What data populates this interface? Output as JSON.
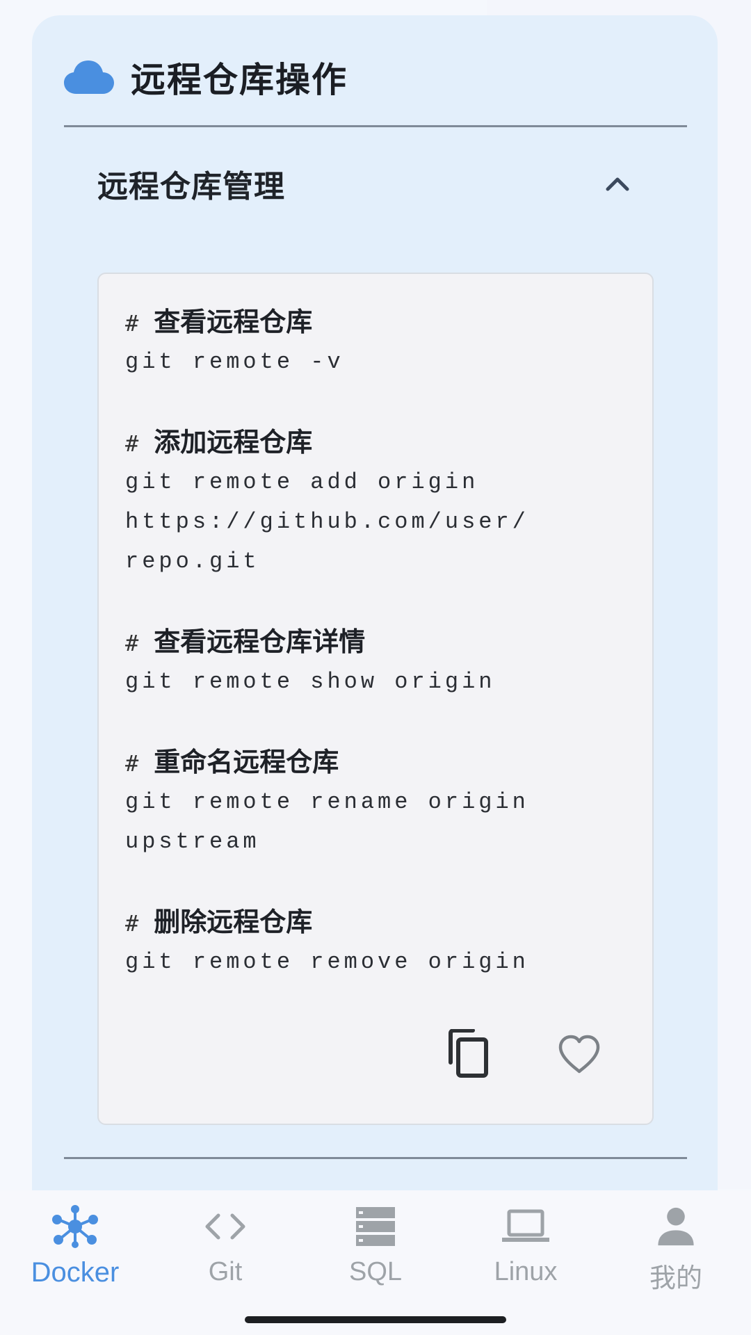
{
  "header": {
    "title": "远程仓库操作",
    "icon": "cloud-icon",
    "icon_color": "#4a8fe0"
  },
  "subsection": {
    "title": "远程仓库管理",
    "icon": "chevron-up-icon",
    "expanded": true
  },
  "code_blocks": [
    {
      "comment_hash": "#",
      "comment": "查看远程仓库",
      "lines": [
        "git remote -v"
      ]
    },
    {
      "comment_hash": "#",
      "comment": "添加远程仓库",
      "lines": [
        "git remote add origin",
        "https://github.com/user/",
        "repo.git"
      ]
    },
    {
      "comment_hash": "#",
      "comment": "查看远程仓库详情",
      "lines": [
        "git remote show origin"
      ]
    },
    {
      "comment_hash": "#",
      "comment": "重命名远程仓库",
      "lines": [
        "git remote rename origin",
        "upstream"
      ]
    },
    {
      "comment_hash": "#",
      "comment": "删除远程仓库",
      "lines": [
        "git remote remove origin"
      ]
    }
  ],
  "actions": {
    "copy_icon": "copy-icon",
    "favorite_icon": "heart-icon"
  },
  "nav": {
    "active_color": "#4a8fe0",
    "inactive_color": "#9ea3a8",
    "items": [
      {
        "label": "Docker",
        "icon": "docker-network-icon",
        "active": true
      },
      {
        "label": "Git",
        "icon": "code-brackets-icon",
        "active": false
      },
      {
        "label": "SQL",
        "icon": "database-icon",
        "active": false
      },
      {
        "label": "Linux",
        "icon": "laptop-icon",
        "active": false
      },
      {
        "label": "我的",
        "icon": "person-icon",
        "active": false
      }
    ]
  }
}
